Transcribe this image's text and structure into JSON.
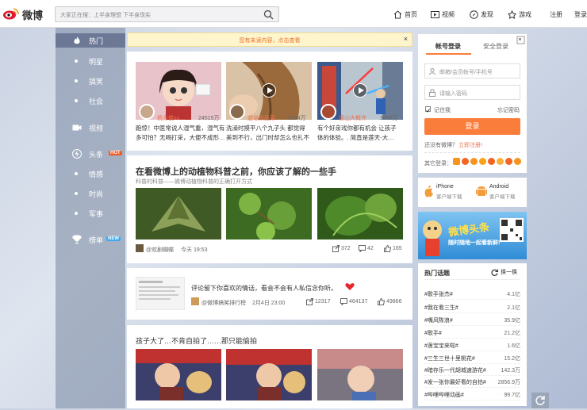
{
  "header": {
    "logo": "微博",
    "search_placeholder": "大家正在搜：上半身理想 下半身现实",
    "nav": [
      "首页",
      "视频",
      "发现",
      "游戏",
      "注册",
      "登录"
    ]
  },
  "leftnav": {
    "items": [
      "热门",
      "明星",
      "搞笑",
      "社会",
      "视频",
      "头条",
      "情感",
      "时尚",
      "军事",
      "榜单"
    ],
    "badges": {
      "hot": "HOT",
      "new": "NEW"
    }
  },
  "notice": {
    "text": "您有未读内容，点击查看",
    "close": "×"
  },
  "videos": [
    {
      "name": "杨方俊su…",
      "count": "24515万",
      "desc": "跑惊！中医常说人湿气重，湿气有\n多可怕？无喝打采，大便不成形…"
    },
    {
      "name": "迦诺权品菜",
      "count": "6294万",
      "desc": "洗澡时摸平八个九子头 都觉得\n美到不行，出门时却怎么也扎不"
    },
    {
      "name": "唐山大概齐",
      "count": "3896万",
      "desc": "有个好亲戏你都有机会 让孩子\n体的体验。. 简直是莲天-大…"
    }
  ],
  "card2": {
    "title": "在看微博上的动植物科普之前，你应该了解的一些手",
    "subtitle": "科普的科普——微博动植物科普的正确打开方式",
    "author": "@欢剧蝴蝶",
    "time": "今天 19:53",
    "reposts": "372",
    "comments": "42",
    "likes": "165"
  },
  "card3": {
    "text": "评论留下你喜欢的情话，看会不会有人私信念你听。",
    "author": "@微博搞笑排行榜",
    "time": "2月4日 23:00",
    "reposts": "12317",
    "comments": "464137",
    "likes": "49866"
  },
  "card4": {
    "title": "孩子大了…不肯自拍了……那只能偷拍"
  },
  "login": {
    "tab_account": "帐号登录",
    "tab_secure": "安全登录",
    "user_placeholder": "邮箱/会员帐号/手机号",
    "pass_placeholder": "请输入密码",
    "remember": "记住我",
    "forgot": "忘记密码",
    "submit": "登录",
    "no_account": "还没有微博？",
    "register": "立即注册!",
    "other": "其它登录："
  },
  "app": {
    "iphone": "iPhone",
    "iphone_sub": "客户端下载",
    "android": "Android",
    "android_sub": "客户端下载"
  },
  "ad": {
    "title": "微博头条",
    "sub": "随时随地一起看新鲜!"
  },
  "hot": {
    "title": "热门话题",
    "refresh": "换一换",
    "topics": [
      {
        "name": "#歌手张杰#",
        "value": "4.1亿"
      },
      {
        "name": "#我在看三生#",
        "value": "2.1亿"
      },
      {
        "name": "#嘴风陈浪#",
        "value": "35.9亿"
      },
      {
        "name": "#歌手#",
        "value": "21.2亿"
      },
      {
        "name": "#莲宝宝来啦#",
        "value": "1.6亿"
      },
      {
        "name": "#三生三世十里桃花#",
        "value": "15.2亿"
      },
      {
        "name": "#暗存乐一代胡城速游花#",
        "value": "142.3万"
      },
      {
        "name": "#发一张你最好看的自拍#",
        "value": "2856.9万"
      },
      {
        "name": "#哔哩哔哩动画#",
        "value": "99.7亿"
      }
    ]
  },
  "colors": {
    "accent": "#fa7d3c",
    "link": "#eb7350",
    "brand_red": "#e6162d"
  }
}
